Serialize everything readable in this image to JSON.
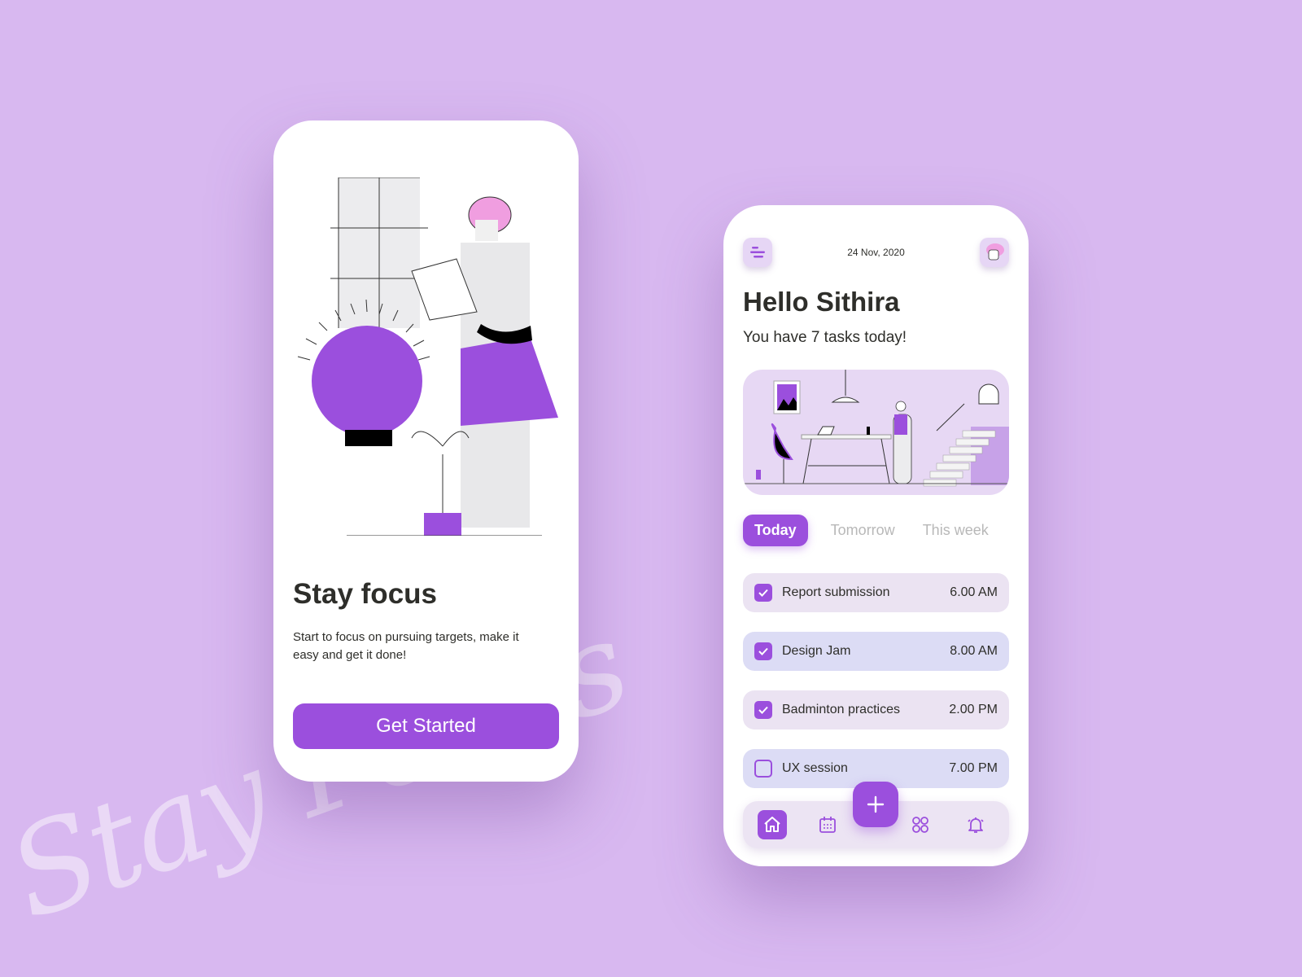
{
  "background": {
    "watermark": "Stay Focus",
    "accent": "#9b4fdd"
  },
  "onboarding": {
    "illustration": "person-with-lightbulb-illustration",
    "title": "Stay focus",
    "description": "Start to focus on pursuing targets, make it easy and get it done!",
    "button_label": "Get Started"
  },
  "home": {
    "menu_icon": "menu-icon",
    "date": "24 Nov, 2020",
    "avatar_icon": "avatar-icon",
    "greeting": "Hello Sithira",
    "subtitle": "You have 7 tasks today!",
    "banner": "office-stairs-illustration",
    "tabs": [
      {
        "label": "Today",
        "active": true
      },
      {
        "label": "Tomorrow",
        "active": false
      },
      {
        "label": "This week",
        "active": false
      }
    ],
    "tasks": [
      {
        "name": "Report submission",
        "time": "6.00 AM",
        "done": true
      },
      {
        "name": "Design Jam",
        "time": "8.00 AM",
        "done": true
      },
      {
        "name": "Badminton practices",
        "time": "2.00 PM",
        "done": true
      },
      {
        "name": "UX session",
        "time": "7.00 PM",
        "done": false
      }
    ],
    "nav": [
      {
        "icon": "home-icon",
        "active": true
      },
      {
        "icon": "calendar-icon",
        "active": false
      },
      {
        "icon": "add-icon",
        "active": false
      },
      {
        "icon": "grid-icon",
        "active": false
      },
      {
        "icon": "bell-icon",
        "active": false
      }
    ]
  }
}
